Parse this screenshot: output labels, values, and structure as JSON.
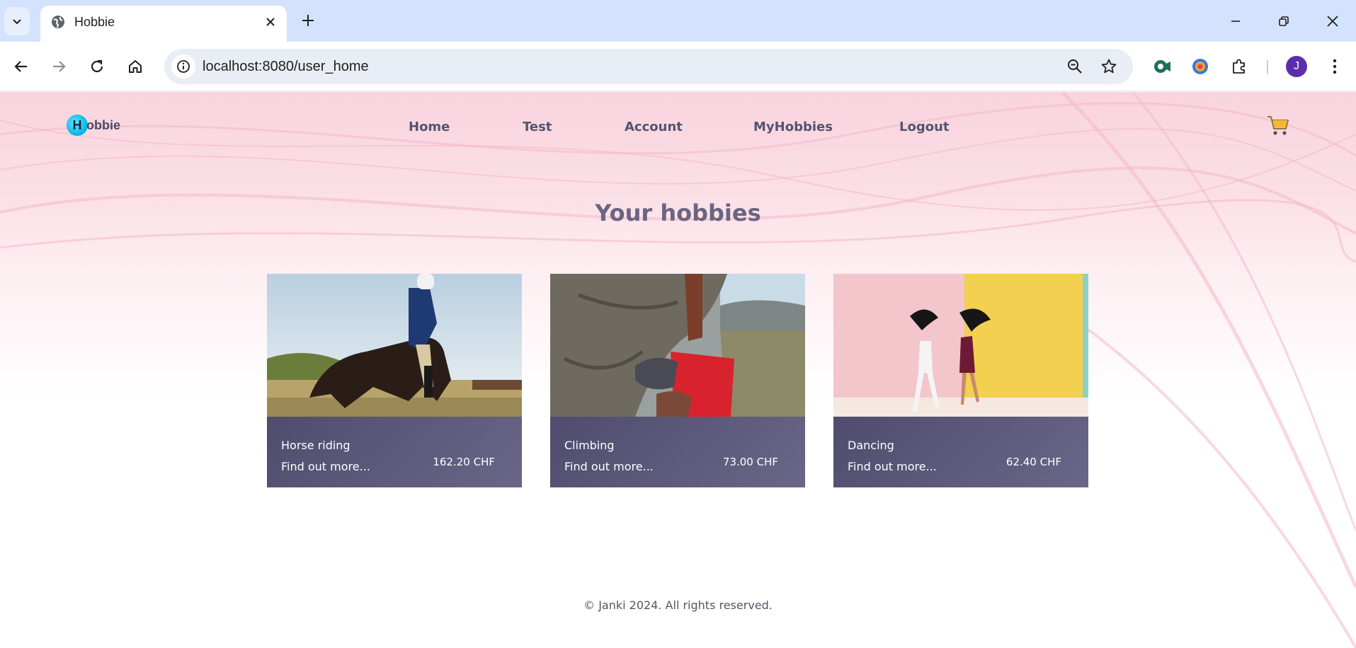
{
  "browser": {
    "tab_title": "Hobbie",
    "url": "localhost:8080/user_home",
    "profile_initial": "J"
  },
  "site": {
    "logo_letter": "H",
    "logo_text": "obbie",
    "nav": [
      "Home",
      "Test",
      "Account",
      "MyHobbies",
      "Logout"
    ],
    "page_title": "Your hobbies",
    "hobbies": [
      {
        "name": "Horse riding",
        "more": "Find out more...",
        "price": "162.20 CHF"
      },
      {
        "name": "Climbing",
        "more": "Find out more...",
        "price": "73.00 CHF"
      },
      {
        "name": "Dancing",
        "more": "Find out more...",
        "price": "62.40 CHF"
      }
    ],
    "footer": "© Janki 2024. All rights reserved."
  },
  "colors": {
    "accent": "#d3e3fd",
    "card": "#5b5878",
    "nav_text": "#55536f",
    "title": "#6b6582"
  }
}
